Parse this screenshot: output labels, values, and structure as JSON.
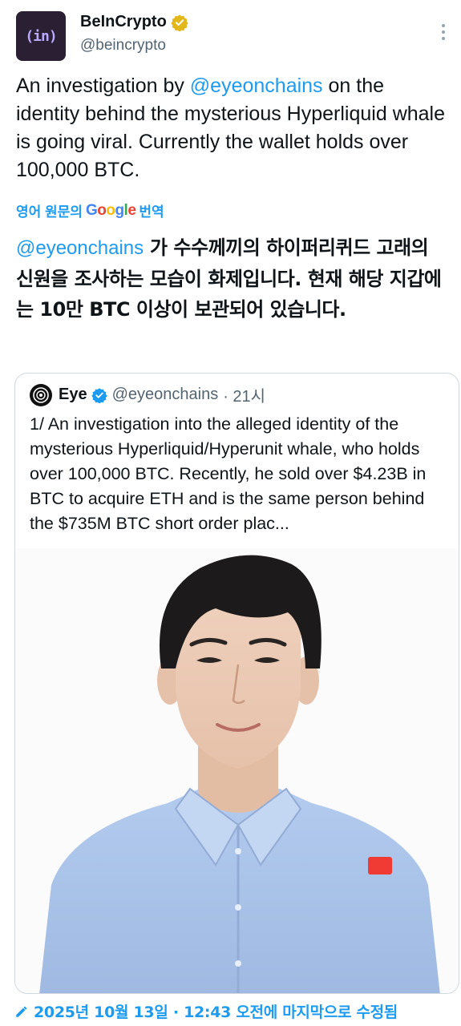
{
  "author": {
    "name": "BeInCrypto",
    "handle": "@beincrypto",
    "avatar_text": "(in)"
  },
  "tweet": {
    "text_part1": "An investigation by ",
    "mention": "@eyeonchains",
    "text_part2": " on the identity behind the mysterious Hyperliquid whale is going viral. Currently the wallet holds over 100,000 BTC."
  },
  "translation": {
    "prefix": "영어 원문의",
    "google": [
      "G",
      "o",
      "o",
      "g",
      "l",
      "e"
    ],
    "suffix": "번역",
    "mention": "@eyeonchains",
    "text": " 가 수수께끼의 하이퍼리퀴드 고래의 신원을 조사하는 모습이 화제입니다. 현재 해당 지갑에는 10만 BTC 이상이 보관되어 있습니다."
  },
  "quote": {
    "name": "Eye",
    "handle": "@eyeonchains",
    "time": "· 21시",
    "text": "1/ An investigation into the alleged identity of the mysterious Hyperliquid/Hyperunit whale, who holds over 100,000 BTC. Recently, he sold over $4.23B in BTC to acquire ETH and is the same person behind the $735M BTC short order plac..."
  },
  "footer": {
    "edited": "2025년 10월 13일 · 12:43 오전에 마지막으로 수정됨"
  },
  "colors": {
    "accent": "#1d9bf0",
    "verified_gold": "#e2b719",
    "shirt": "#a9c3e8"
  },
  "icons": [
    "verified-gold-icon",
    "more-icon",
    "verified-blue-icon",
    "eye-avatar-icon",
    "pencil-icon"
  ]
}
